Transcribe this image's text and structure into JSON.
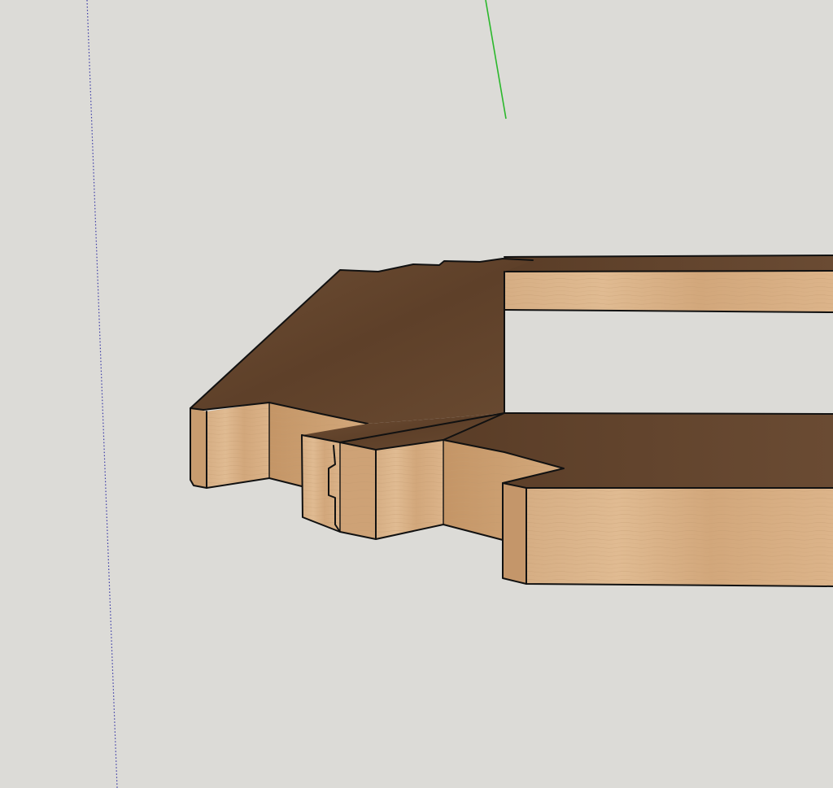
{
  "viewport": {
    "background_color": "#dcdbd7"
  },
  "axes": {
    "red_axis_color": "#3a3aa6",
    "green_axis_color": "#2bb82b"
  },
  "materials": {
    "top_dark": "#6a4a30",
    "top_mid": "#5f4129",
    "top_light": "#72523a",
    "side_light": "#d9b58c",
    "side_mid": "#cfa77c",
    "side_shade": "#b98c60",
    "edge_color": "#111111"
  }
}
